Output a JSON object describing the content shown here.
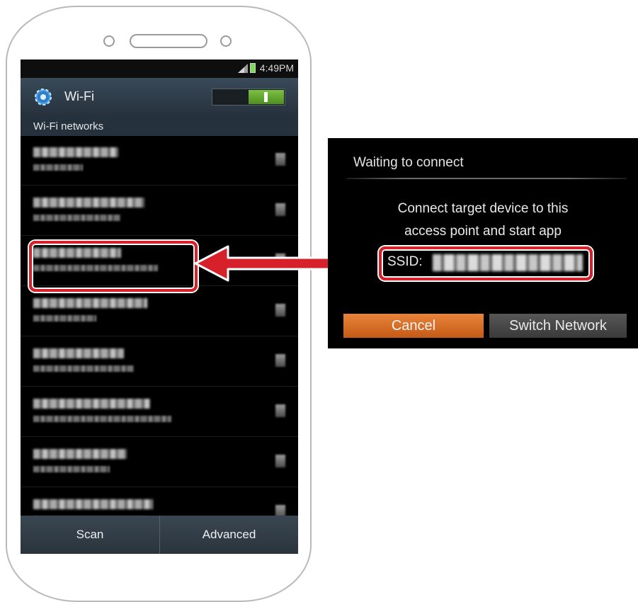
{
  "status_bar": {
    "time": "4:49PM"
  },
  "wifi_screen": {
    "title": "Wi-Fi",
    "section_header": "Wi-Fi networks",
    "toggle_on": true,
    "network_count": 8,
    "highlighted_network_index": 2,
    "bottom_buttons": {
      "scan": "Scan",
      "advanced": "Advanced"
    }
  },
  "dialog": {
    "title": "Waiting to connect",
    "message_line1": "Connect target device to this",
    "message_line2": "access point and start app",
    "ssid_label": "SSID:",
    "cancel_label": "Cancel",
    "switch_network_label": "Switch Network"
  },
  "colors": {
    "highlight_red": "#d6202a",
    "cancel_orange": "#e9843a",
    "toggle_green": "#7cc043",
    "actionbar": "#3a4a59"
  },
  "icons": [
    "gear-icon",
    "signal-icon",
    "battery-icon",
    "wifi-signal-icon",
    "arrow-icon"
  ]
}
